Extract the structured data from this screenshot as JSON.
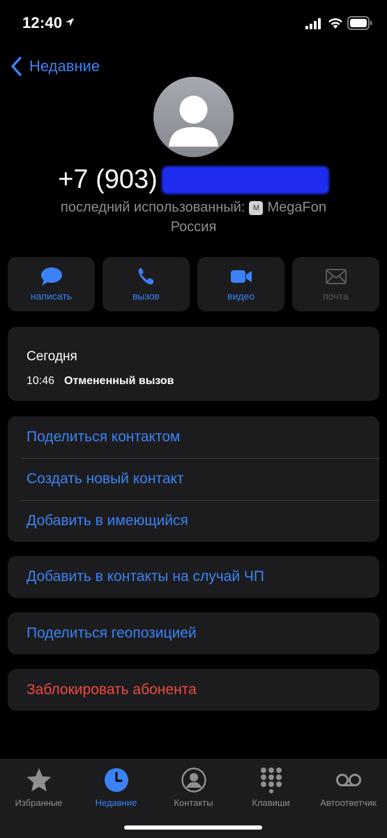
{
  "status": {
    "time": "12:40"
  },
  "nav": {
    "back_label": "Недавние"
  },
  "contact": {
    "phone_prefix": "+7 (903)",
    "sim_prefix": "последний использованный:",
    "sim_badge": "M",
    "carrier": "MegaFon",
    "country": "Россия"
  },
  "actions": [
    {
      "label": "написать",
      "icon": "message-icon"
    },
    {
      "label": "вызов",
      "icon": "phone-icon"
    },
    {
      "label": "видео",
      "icon": "video-icon"
    },
    {
      "label": "почта",
      "icon": "mail-icon"
    }
  ],
  "history": {
    "day": "Сегодня",
    "time": "10:46",
    "status": "Отмененный вызов"
  },
  "menu": {
    "share_contact": "Поделиться контактом",
    "create_contact": "Создать новый контакт",
    "add_existing": "Добавить в имеющийся",
    "add_emergency": "Добавить в контакты на случай ЧП",
    "share_location": "Поделиться геопозицией",
    "block": "Заблокировать абонента"
  },
  "tabs": [
    {
      "label": "Избранные",
      "icon": "star-icon"
    },
    {
      "label": "Недавние",
      "icon": "clock-icon"
    },
    {
      "label": "Контакты",
      "icon": "person-circle-icon"
    },
    {
      "label": "Клавиши",
      "icon": "keypad-icon"
    },
    {
      "label": "Автоответчик",
      "icon": "voicemail-icon"
    }
  ],
  "colors": {
    "accent": "#3b82f6",
    "danger": "#ee4a42",
    "card": "#1c1c1e",
    "secondary": "#8e8e93"
  }
}
